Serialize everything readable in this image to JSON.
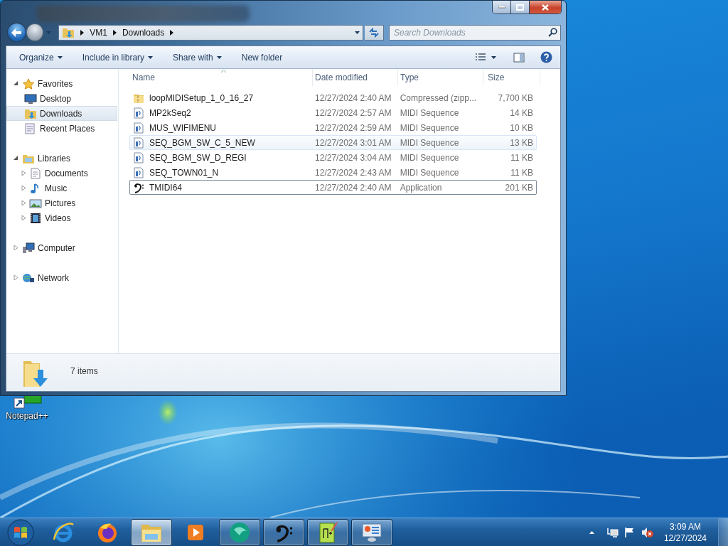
{
  "window": {
    "breadcrumb": [
      "VM1",
      "Downloads"
    ],
    "search": {
      "placeholder": "Search Downloads"
    },
    "toolbar": [
      {
        "label": "Organize",
        "dropdown": true
      },
      {
        "label": "Include in library",
        "dropdown": true
      },
      {
        "label": "Share with",
        "dropdown": true
      },
      {
        "label": "New folder",
        "dropdown": false
      }
    ],
    "nav": [
      {
        "label": "Favorites",
        "kind": "favorites",
        "expanded": true,
        "selected": false,
        "children": [
          {
            "label": "Desktop",
            "kind": "desktop",
            "selected": false
          },
          {
            "label": "Downloads",
            "kind": "downloads",
            "selected": true
          },
          {
            "label": "Recent Places",
            "kind": "recent",
            "selected": false
          }
        ]
      },
      {
        "label": "Libraries",
        "kind": "libraries",
        "expanded": true,
        "selected": false,
        "children": [
          {
            "label": "Documents",
            "kind": "documents",
            "expanded": false,
            "selected": false
          },
          {
            "label": "Music",
            "kind": "music",
            "expanded": false,
            "selected": false
          },
          {
            "label": "Pictures",
            "kind": "pictures",
            "expanded": false,
            "selected": false
          },
          {
            "label": "Videos",
            "kind": "videos",
            "expanded": false,
            "selected": false
          }
        ]
      },
      {
        "label": "Computer",
        "kind": "computer",
        "expanded": false,
        "selected": false
      },
      {
        "label": "Network",
        "kind": "network",
        "expanded": false,
        "selected": false
      }
    ],
    "columns": [
      {
        "label": "Name",
        "sorted": true
      },
      {
        "label": "Date modified",
        "sorted": false
      },
      {
        "label": "Type",
        "sorted": false
      },
      {
        "label": "Size",
        "sorted": false
      }
    ],
    "files": [
      {
        "name": "loopMIDISetup_1_0_16_27",
        "date": "12/27/2024 2:40 AM",
        "type": "Compressed (zipp...",
        "size": "7,700 KB",
        "kind": "zip",
        "hovered": false,
        "focused": false
      },
      {
        "name": "MP2kSeq2",
        "date": "12/27/2024 2:57 AM",
        "type": "MIDI Sequence",
        "size": "14 KB",
        "kind": "midi",
        "hovered": false,
        "focused": false
      },
      {
        "name": "MUS_WIFIMENU",
        "date": "12/27/2024 2:59 AM",
        "type": "MIDI Sequence",
        "size": "10 KB",
        "kind": "midi",
        "hovered": false,
        "focused": false
      },
      {
        "name": "SEQ_BGM_SW_C_5_NEW",
        "date": "12/27/2024 3:01 AM",
        "type": "MIDI Sequence",
        "size": "13 KB",
        "kind": "midi",
        "hovered": true,
        "focused": false
      },
      {
        "name": "SEQ_BGM_SW_D_REGI",
        "date": "12/27/2024 3:04 AM",
        "type": "MIDI Sequence",
        "size": "11 KB",
        "kind": "midi",
        "hovered": false,
        "focused": false
      },
      {
        "name": "SEQ_TOWN01_N",
        "date": "12/27/2024 2:43 AM",
        "type": "MIDI Sequence",
        "size": "11 KB",
        "kind": "midi",
        "hovered": false,
        "focused": false
      },
      {
        "name": "TMIDI64",
        "date": "12/27/2024 2:40 AM",
        "type": "Application",
        "size": "201 KB",
        "kind": "app",
        "hovered": false,
        "focused": true
      }
    ],
    "status": {
      "count": "7 items"
    }
  },
  "desktop_icons": [
    {
      "label": "Notepad++"
    }
  ],
  "taskbar": {
    "items": [
      {
        "kind": "start",
        "running": false,
        "selected": false
      },
      {
        "kind": "ie",
        "running": false,
        "selected": false
      },
      {
        "kind": "firefox",
        "running": false,
        "selected": false
      },
      {
        "kind": "explorer",
        "running": true,
        "selected": true
      },
      {
        "kind": "media",
        "running": false,
        "selected": false
      },
      {
        "kind": "green",
        "running": true,
        "selected": false
      },
      {
        "kind": "clef",
        "running": true,
        "selected": false
      },
      {
        "kind": "notepad",
        "running": true,
        "selected": false
      },
      {
        "kind": "control",
        "running": true,
        "selected": false
      }
    ],
    "tray": {
      "volume_muted": true
    },
    "clock": {
      "time": "3:09 AM",
      "date": "12/27/2024"
    }
  }
}
